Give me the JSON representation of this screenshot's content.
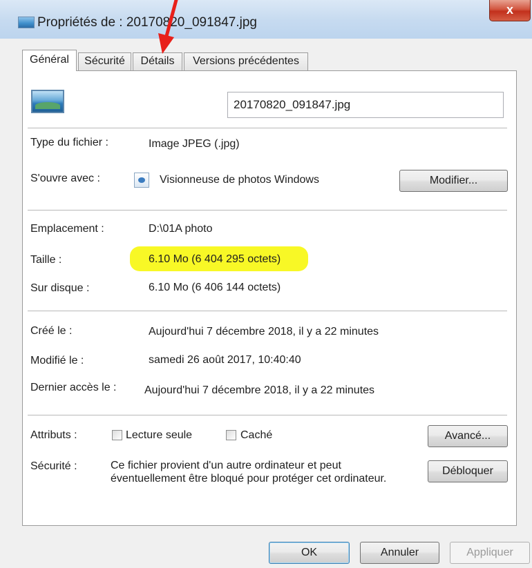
{
  "window": {
    "title": "Propriétés de : 20170820_091847.jpg",
    "close_label": "x"
  },
  "tabs": [
    {
      "label": "Général",
      "active": true
    },
    {
      "label": "Sécurité",
      "active": false
    },
    {
      "label": "Détails",
      "active": false
    },
    {
      "label": "Versions précédentes",
      "active": false
    }
  ],
  "general": {
    "file_name": "20170820_091847.jpg",
    "file_type_label": "Type du fichier :",
    "file_type_value": "Image JPEG (.jpg)",
    "opens_with_label": "S'ouvre avec :",
    "opens_with_value": "Visionneuse de photos Windows",
    "change_button": "Modifier...",
    "location_label": "Emplacement :",
    "location_value": "D:\\01A photo",
    "size_label": "Taille :",
    "size_value": "6.10 Mo (6 404 295 octets)",
    "disk_label": "Sur disque :",
    "disk_value": "6.10 Mo (6 406 144 octets)",
    "created_label": "Créé le :",
    "created_value": "Aujourd'hui 7 décembre 2018, il y a 22 minutes",
    "modified_label": "Modifié le :",
    "modified_value": "samedi 26 août 2017, 10:40:40",
    "accessed_label": "Dernier accès le :",
    "accessed_value": "Aujourd'hui 7 décembre 2018, il y a 22 minutes",
    "attributes_label": "Attributs :",
    "readonly_label": "Lecture seule",
    "hidden_label": "Caché",
    "advanced_button": "Avancé...",
    "security_label": "Sécurité :",
    "security_line1": "Ce fichier provient d'un autre ordinateur et peut",
    "security_line2": "éventuellement être bloqué pour protéger cet ordinateur.",
    "unblock_button": "Débloquer"
  },
  "footer": {
    "ok": "OK",
    "cancel": "Annuler",
    "apply": "Appliquer"
  },
  "colors": {
    "highlight": "#f7f700",
    "arrow": "#e8201a"
  },
  "icons": {
    "title": "image-file-icon",
    "file": "image-file-icon",
    "app": "photo-viewer-icon",
    "annotation": "red-arrow-icon"
  }
}
